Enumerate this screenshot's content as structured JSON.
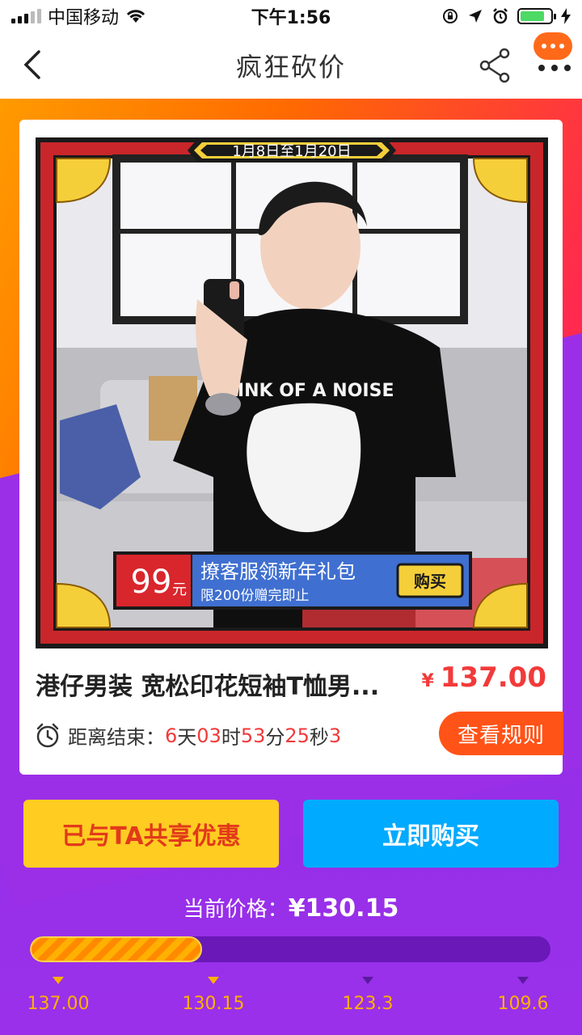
{
  "status_bar": {
    "carrier": "中国移动",
    "time": "下午1:56"
  },
  "nav": {
    "title": "疯狂砍价"
  },
  "poster": {
    "date_banner": "1月8日至1月20日",
    "tshirt_text": "THINK OF A NOISE",
    "promo_price": "99",
    "promo_unit": "元",
    "promo_title": "撩客服领新年礼包",
    "promo_sub": "限200份赠完即止",
    "promo_buy": "购买"
  },
  "product": {
    "title": "港仔男装 宽松印花短袖T恤男...",
    "currency": "¥",
    "price": "137.00"
  },
  "countdown": {
    "label": "距离结束：",
    "days": "6",
    "days_unit": "天",
    "hours": "03",
    "hours_unit": "时",
    "minutes": "53",
    "minutes_unit": "分",
    "seconds": "25",
    "seconds_unit": "秒",
    "tenths": "3"
  },
  "buttons": {
    "rules": "查看规则",
    "share": "已与TA共享优惠",
    "buy": "立即购买"
  },
  "current_price": {
    "label": "当前价格：",
    "value": "¥130.15"
  },
  "progress": {
    "fill_fraction": 0.33,
    "marks": [
      {
        "label": "137.00",
        "reached": true
      },
      {
        "label": "130.15",
        "reached": true
      },
      {
        "label": "123.3",
        "reached": false
      },
      {
        "label": "109.6",
        "reached": false
      }
    ]
  },
  "colors": {
    "accent_red": "#f23a3a",
    "orange": "#ff5317",
    "yellow": "#ffcc22",
    "blue": "#00aaff",
    "purple": "#9b2fe8"
  }
}
